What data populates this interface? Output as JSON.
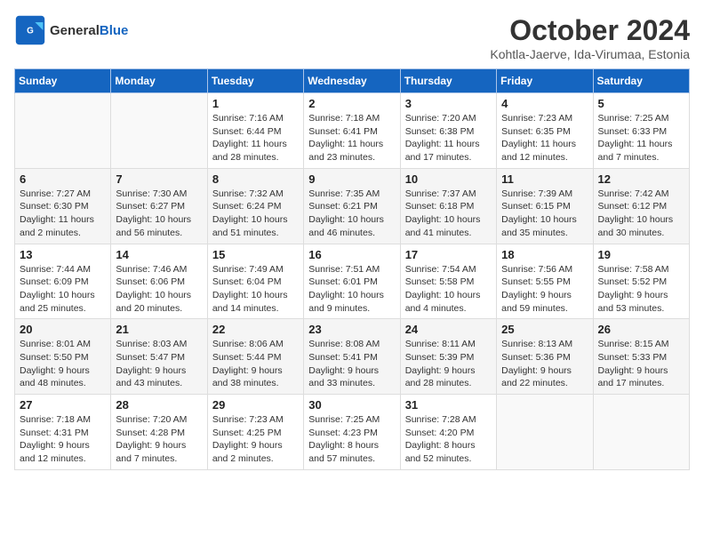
{
  "header": {
    "logo_general": "General",
    "logo_blue": "Blue",
    "month": "October 2024",
    "location": "Kohtla-Jaerve, Ida-Virumaa, Estonia"
  },
  "weekdays": [
    "Sunday",
    "Monday",
    "Tuesday",
    "Wednesday",
    "Thursday",
    "Friday",
    "Saturday"
  ],
  "weeks": [
    [
      {
        "day": "",
        "info": ""
      },
      {
        "day": "",
        "info": ""
      },
      {
        "day": "1",
        "info": "Sunrise: 7:16 AM\nSunset: 6:44 PM\nDaylight: 11 hours and 28 minutes."
      },
      {
        "day": "2",
        "info": "Sunrise: 7:18 AM\nSunset: 6:41 PM\nDaylight: 11 hours and 23 minutes."
      },
      {
        "day": "3",
        "info": "Sunrise: 7:20 AM\nSunset: 6:38 PM\nDaylight: 11 hours and 17 minutes."
      },
      {
        "day": "4",
        "info": "Sunrise: 7:23 AM\nSunset: 6:35 PM\nDaylight: 11 hours and 12 minutes."
      },
      {
        "day": "5",
        "info": "Sunrise: 7:25 AM\nSunset: 6:33 PM\nDaylight: 11 hours and 7 minutes."
      }
    ],
    [
      {
        "day": "6",
        "info": "Sunrise: 7:27 AM\nSunset: 6:30 PM\nDaylight: 11 hours and 2 minutes."
      },
      {
        "day": "7",
        "info": "Sunrise: 7:30 AM\nSunset: 6:27 PM\nDaylight: 10 hours and 56 minutes."
      },
      {
        "day": "8",
        "info": "Sunrise: 7:32 AM\nSunset: 6:24 PM\nDaylight: 10 hours and 51 minutes."
      },
      {
        "day": "9",
        "info": "Sunrise: 7:35 AM\nSunset: 6:21 PM\nDaylight: 10 hours and 46 minutes."
      },
      {
        "day": "10",
        "info": "Sunrise: 7:37 AM\nSunset: 6:18 PM\nDaylight: 10 hours and 41 minutes."
      },
      {
        "day": "11",
        "info": "Sunrise: 7:39 AM\nSunset: 6:15 PM\nDaylight: 10 hours and 35 minutes."
      },
      {
        "day": "12",
        "info": "Sunrise: 7:42 AM\nSunset: 6:12 PM\nDaylight: 10 hours and 30 minutes."
      }
    ],
    [
      {
        "day": "13",
        "info": "Sunrise: 7:44 AM\nSunset: 6:09 PM\nDaylight: 10 hours and 25 minutes."
      },
      {
        "day": "14",
        "info": "Sunrise: 7:46 AM\nSunset: 6:06 PM\nDaylight: 10 hours and 20 minutes."
      },
      {
        "day": "15",
        "info": "Sunrise: 7:49 AM\nSunset: 6:04 PM\nDaylight: 10 hours and 14 minutes."
      },
      {
        "day": "16",
        "info": "Sunrise: 7:51 AM\nSunset: 6:01 PM\nDaylight: 10 hours and 9 minutes."
      },
      {
        "day": "17",
        "info": "Sunrise: 7:54 AM\nSunset: 5:58 PM\nDaylight: 10 hours and 4 minutes."
      },
      {
        "day": "18",
        "info": "Sunrise: 7:56 AM\nSunset: 5:55 PM\nDaylight: 9 hours and 59 minutes."
      },
      {
        "day": "19",
        "info": "Sunrise: 7:58 AM\nSunset: 5:52 PM\nDaylight: 9 hours and 53 minutes."
      }
    ],
    [
      {
        "day": "20",
        "info": "Sunrise: 8:01 AM\nSunset: 5:50 PM\nDaylight: 9 hours and 48 minutes."
      },
      {
        "day": "21",
        "info": "Sunrise: 8:03 AM\nSunset: 5:47 PM\nDaylight: 9 hours and 43 minutes."
      },
      {
        "day": "22",
        "info": "Sunrise: 8:06 AM\nSunset: 5:44 PM\nDaylight: 9 hours and 38 minutes."
      },
      {
        "day": "23",
        "info": "Sunrise: 8:08 AM\nSunset: 5:41 PM\nDaylight: 9 hours and 33 minutes."
      },
      {
        "day": "24",
        "info": "Sunrise: 8:11 AM\nSunset: 5:39 PM\nDaylight: 9 hours and 28 minutes."
      },
      {
        "day": "25",
        "info": "Sunrise: 8:13 AM\nSunset: 5:36 PM\nDaylight: 9 hours and 22 minutes."
      },
      {
        "day": "26",
        "info": "Sunrise: 8:15 AM\nSunset: 5:33 PM\nDaylight: 9 hours and 17 minutes."
      }
    ],
    [
      {
        "day": "27",
        "info": "Sunrise: 7:18 AM\nSunset: 4:31 PM\nDaylight: 9 hours and 12 minutes."
      },
      {
        "day": "28",
        "info": "Sunrise: 7:20 AM\nSunset: 4:28 PM\nDaylight: 9 hours and 7 minutes."
      },
      {
        "day": "29",
        "info": "Sunrise: 7:23 AM\nSunset: 4:25 PM\nDaylight: 9 hours and 2 minutes."
      },
      {
        "day": "30",
        "info": "Sunrise: 7:25 AM\nSunset: 4:23 PM\nDaylight: 8 hours and 57 minutes."
      },
      {
        "day": "31",
        "info": "Sunrise: 7:28 AM\nSunset: 4:20 PM\nDaylight: 8 hours and 52 minutes."
      },
      {
        "day": "",
        "info": ""
      },
      {
        "day": "",
        "info": ""
      }
    ]
  ]
}
